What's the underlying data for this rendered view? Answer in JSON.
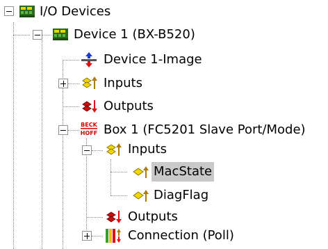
{
  "tree": {
    "root": {
      "label": "I/O Devices",
      "icon": "io-devices-icon",
      "expanded": true
    },
    "device1": {
      "label": "Device 1 (BX-B520)",
      "icon": "device-icon",
      "expanded": true
    },
    "image": {
      "label": "Device 1-Image",
      "icon": "process-image-icon"
    },
    "dev_inputs": {
      "label": "Inputs",
      "icon": "inputs-icon",
      "expanded": false
    },
    "dev_outputs": {
      "label": "Outputs",
      "icon": "outputs-icon"
    },
    "box1": {
      "label": "Box 1 (FC5201 Slave Port/Mode)",
      "icon": "beckhoff-box-icon",
      "icon_text_top": "BECK",
      "icon_text_bottom": "HOFF",
      "expanded": true
    },
    "box_inputs": {
      "label": "Inputs",
      "icon": "inputs-icon",
      "expanded": true
    },
    "macstate": {
      "label": "MacState",
      "icon": "input-variable-icon",
      "selected": true
    },
    "diagflag": {
      "label": "DiagFlag",
      "icon": "input-variable-icon"
    },
    "box_outputs": {
      "label": "Outputs",
      "icon": "outputs-icon"
    },
    "connection": {
      "label": "Connection (Poll)",
      "icon": "connection-icon",
      "expanded": false
    }
  },
  "colors": {
    "selection": "#c9c9c9",
    "tree_lines": "#8a8a8a",
    "beckhoff_red": "#d40000"
  }
}
